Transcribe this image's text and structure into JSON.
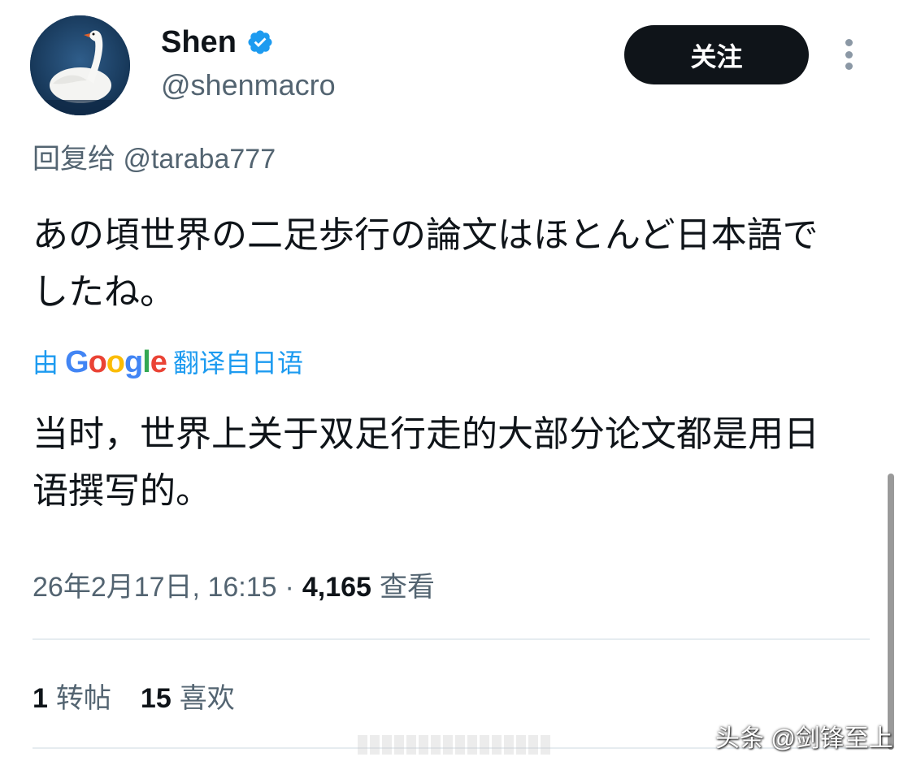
{
  "profile": {
    "display_name": "Shen",
    "handle": "@shenmacro",
    "verified": true,
    "avatar_icon": "swan-avatar-icon"
  },
  "actions": {
    "follow_label": "关注",
    "more_icon": "more-vertical-icon"
  },
  "reply": {
    "prefix": "回复给",
    "mention": "@taraba777"
  },
  "tweet": {
    "text": "あの頃世界の二足歩行の論文はほとんど日本語でしたね。"
  },
  "translation": {
    "by": "由",
    "provider": "Google",
    "suffix": "翻译自日语",
    "text": "当时，世界上关于双足行走的大部分论文都是用日语撰写的。"
  },
  "meta": {
    "datetime": "26年2月17日, 16:15",
    "separator": "·",
    "views_count": "4,165",
    "views_label": "查看"
  },
  "engagement": {
    "reposts_count": "1",
    "reposts_label": "转帖",
    "likes_count": "15",
    "likes_label": "喜欢"
  },
  "watermark": "头条 @剑锋至上",
  "colors": {
    "text_primary": "#0f1419",
    "text_secondary": "#536471",
    "accent_blue": "#1d9bf0",
    "follow_button_bg": "#0f1419"
  }
}
